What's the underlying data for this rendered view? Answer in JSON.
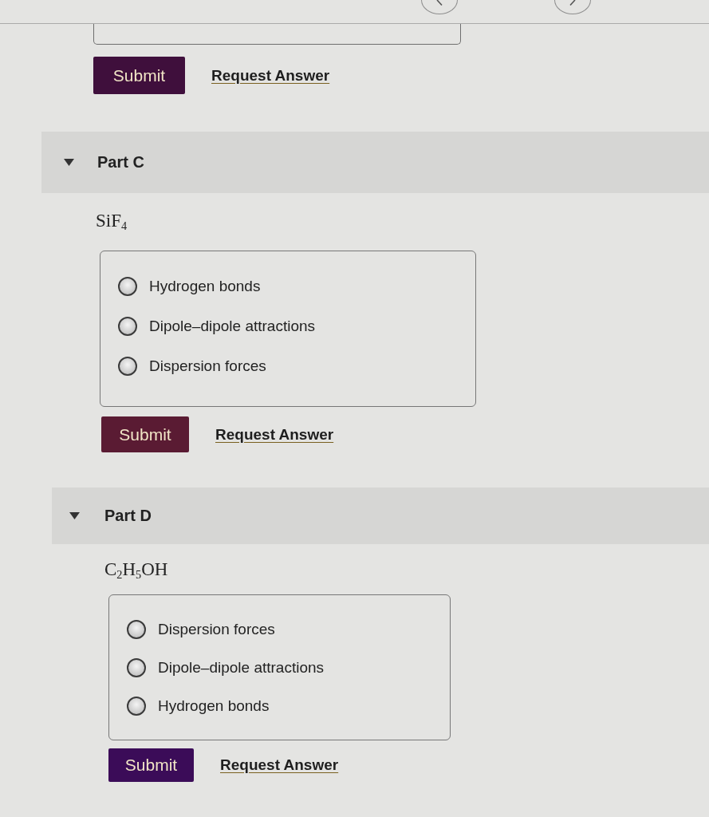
{
  "previous_part": {
    "submit": "Submit",
    "request_answer": "Request Answer"
  },
  "parts": [
    {
      "title": "Part C",
      "expanded": true,
      "prompt": "SiF$_{4}$",
      "options": [
        {
          "label": "Hydrogen bonds",
          "selected": false
        },
        {
          "label": "Dipole–dipole attractions",
          "selected": false
        },
        {
          "label": "Dispersion forces",
          "selected": false
        }
      ],
      "submit": "Submit",
      "request_answer": "Request Answer"
    },
    {
      "title": "Part D",
      "expanded": true,
      "prompt": "C$_{2}$H$_{5}$OH",
      "options": [
        {
          "label": "Dispersion forces",
          "selected": false
        },
        {
          "label": "Dipole–dipole attractions",
          "selected": false
        },
        {
          "label": "Hydrogen bonds",
          "selected": false
        }
      ],
      "submit": "Submit",
      "request_answer": "Request Answer"
    }
  ]
}
